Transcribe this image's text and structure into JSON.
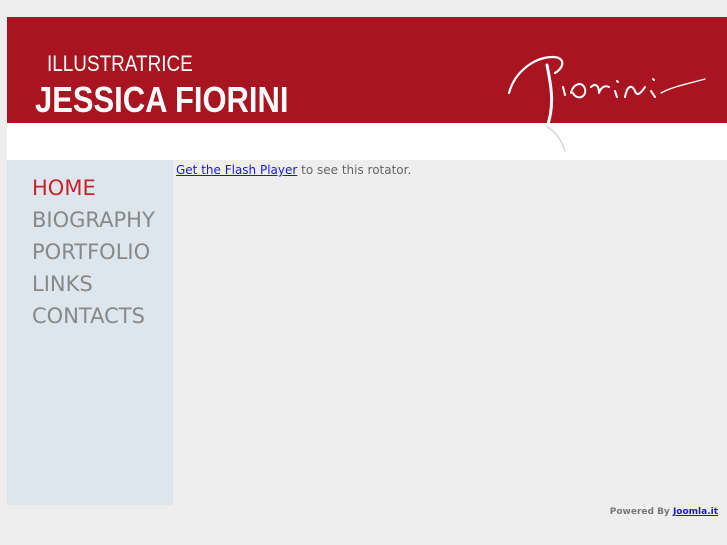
{
  "header": {
    "subtitle": "ILLUSTRATRICE",
    "name": "JESSICA FIORINI",
    "signature_icon": "signature-logo",
    "band_color": "#a8141f"
  },
  "menu": {
    "items": [
      {
        "label": "HOME",
        "active": true
      },
      {
        "label": "BIOGRAPHY",
        "active": false
      },
      {
        "label": "PORTFOLIO",
        "active": false
      },
      {
        "label": "LINKS",
        "active": false
      },
      {
        "label": "CONTACTS",
        "active": false
      }
    ],
    "active_color": "#c7232e",
    "inactive_color": "#888888"
  },
  "content": {
    "flash_link": "Get the Flash Player",
    "flash_text": " to see this rotator."
  },
  "footer": {
    "powered_by": "Powered By ",
    "link": "Joomla.it"
  }
}
